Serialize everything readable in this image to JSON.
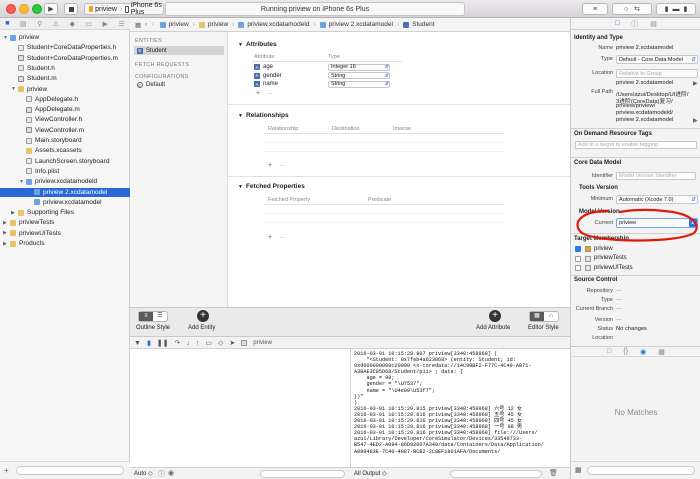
{
  "toolbar": {
    "scheme_name": "priview",
    "device": "iPhone 6s Plus",
    "activity_text": "Running priview on iPhone 6s Plus"
  },
  "navigator": {
    "items": [
      {
        "label": "priview",
        "kind": "project",
        "indent": 0,
        "expanded": true
      },
      {
        "label": "Student+CoreDataProperties.h",
        "kind": "h",
        "indent": 1
      },
      {
        "label": "Student+CoreDataProperties.m",
        "kind": "m",
        "indent": 1
      },
      {
        "label": "Student.h",
        "kind": "h",
        "indent": 1
      },
      {
        "label": "Student.m",
        "kind": "m",
        "indent": 1
      },
      {
        "label": "priview",
        "kind": "folder",
        "indent": 1,
        "expanded": true
      },
      {
        "label": "AppDelegate.h",
        "kind": "h",
        "indent": 2
      },
      {
        "label": "AppDelegate.m",
        "kind": "m",
        "indent": 2
      },
      {
        "label": "ViewController.h",
        "kind": "h",
        "indent": 2
      },
      {
        "label": "ViewController.m",
        "kind": "m",
        "indent": 2
      },
      {
        "label": "Main.storyboard",
        "kind": "sb",
        "indent": 2
      },
      {
        "label": "Assets.xcassets",
        "kind": "folder",
        "indent": 2
      },
      {
        "label": "LaunchScreen.storyboard",
        "kind": "sb",
        "indent": 2
      },
      {
        "label": "Info.plist",
        "kind": "plist",
        "indent": 2
      },
      {
        "label": "priview.xcdatamodeld",
        "kind": "xc",
        "indent": 2,
        "expanded": true
      },
      {
        "label": "priview 2.xcdatamodel",
        "kind": "xc",
        "indent": 3,
        "selected": true
      },
      {
        "label": "priview.xcdatamodel",
        "kind": "xc",
        "indent": 3
      },
      {
        "label": "Supporting Files",
        "kind": "folder",
        "indent": 1,
        "collapsed": true
      },
      {
        "label": "priviewTests",
        "kind": "folder",
        "indent": 0,
        "collapsed": true
      },
      {
        "label": "priviewUITests",
        "kind": "folder",
        "indent": 0,
        "collapsed": true
      },
      {
        "label": "Products",
        "kind": "folder",
        "indent": 0,
        "collapsed": true
      }
    ]
  },
  "jumpbar": {
    "crumbs": [
      "priview",
      "priview",
      "priview.xcdatamodeld",
      "priview 2.xcdatamodel",
      "Student"
    ]
  },
  "entities": {
    "entities_header": "ENTITIES",
    "entity": "Student",
    "fetch_header": "FETCH REQUESTS",
    "config_header": "CONFIGURATIONS",
    "config_default": "Default"
  },
  "editor": {
    "attributes_title": "Attributes",
    "attr_col": "Attribute",
    "type_col": "Type",
    "attributes": [
      {
        "name": "age",
        "type": "Integer 16"
      },
      {
        "name": "gender",
        "type": "String"
      },
      {
        "name": "name",
        "type": "String"
      }
    ],
    "relationships_title": "Relationships",
    "rel_cols": [
      "Relationship",
      "Destination",
      "Inverse"
    ],
    "fetched_title": "Fetched Properties",
    "fetched_cols": [
      "Fetched Property",
      "Predicate"
    ],
    "plus": "+",
    "minus": "–"
  },
  "editorbar": {
    "outline_style": "Outline Style",
    "add_entity": "Add Entity",
    "add_attribute": "Add Attribute",
    "editor_style": "Editor Style"
  },
  "debug": {
    "target": "priview",
    "output_select": "All Output ◇",
    "auto_select": "Auto ◇",
    "console_lines": [
      "2016-03-01 10:15:29.807 priview[3340:458968] (",
      "    \"<Student: 0x7feb4a623868> (entity: Student; id:",
      "0xd000000000c20000 <x-coredata://14C99BF2-F77C-4C49-A871-",
      "A3BAE3C85D68/Student/p11> ; data: {",
      "    age = 98;",
      "    gender = \"\\U7537\";",
      "    name = \"\\U4e09\\U53f7\";",
      "})\"",
      ")",
      "2016-03-01 10:15:29.815 priview[3340:458968] 六号 12 女",
      "2016-03-01 10:15:29.816 priview[3340:458968] 五号 45 女",
      "2016-03-01 10:15:29.816 priview[3340:458968] 四号 45 女",
      "2016-03-01 10:15:29.816 priview[3340:458968] 一号 88 男",
      "2016-03-01 10:15:29.816 priview[3340:458968] file:///Users/",
      "azui/Library/Developer/CoreSimulator/Devices/33549733-",
      "B547-4ED2-A094-86D920D7A349/data/Containers/Data/Application/",
      "A089483E-7C40-4887-BCB2-2C8EF1801AFA/Documents/"
    ]
  },
  "inspector": {
    "identity_type_title": "Identity and Type",
    "name_label": "Name",
    "name_value": "priview 2.xcdatamodel",
    "type_label": "Type",
    "type_value": "Default - Core Data Model",
    "location_label": "Location",
    "location_value": "Relative to Group",
    "location_file": "priview 2.xcdatamodel",
    "fullpath_label": "Full Path",
    "fullpath_lines": [
      "/Users/azui/Desktop/UI进阶/",
      "3进阶(CoreData)复习/",
      "priview/priview/",
      "priview.xcdatamodeld/",
      "priview 2.xcdatamodel"
    ],
    "odr_title": "On Demand Resource Tags",
    "odr_placeholder": "Add to a target to enable tagging",
    "cdm_title": "Core Data Model",
    "identifier_label": "Identifier",
    "identifier_placeholder": "Model Version Identifier",
    "tools_title": "Tools Version",
    "minimum_label": "Minimum",
    "minimum_value": "Automatic (Xcode 7.0)",
    "model_version_title": "Model Version",
    "current_label": "Current",
    "current_value": "priview",
    "target_title": "Target Membership",
    "targets": [
      {
        "name": "priview",
        "checked": true
      },
      {
        "name": "priviewTests",
        "checked": false
      },
      {
        "name": "priviewUITests",
        "checked": false
      }
    ],
    "sc_title": "Source Control",
    "repository_label": "Repository",
    "type2_label": "Type",
    "branch_label": "Current Branch",
    "version_label": "Version",
    "status_label": "Status",
    "status_value": "No changes",
    "location2_label": "Location",
    "no_matches": "No Matches",
    "dash": "—"
  },
  "colors": {
    "selection": "#2a68d6",
    "annotation": "#e0180e"
  }
}
